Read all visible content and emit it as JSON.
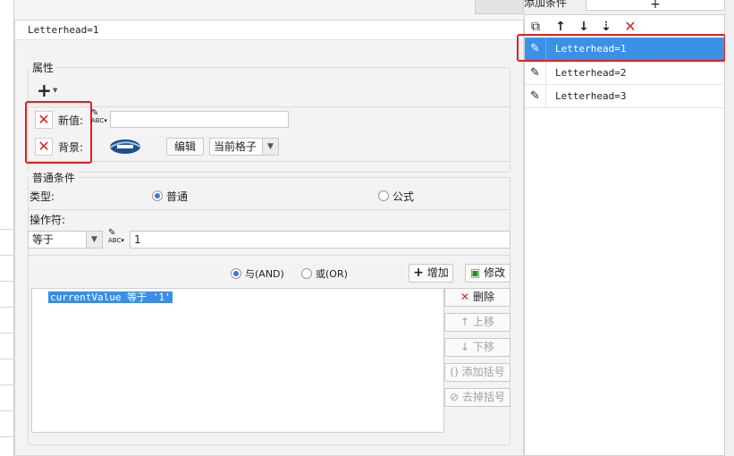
{
  "right_panel": {
    "header_label": "添加条件",
    "add_symbol": "+",
    "toolbar": {
      "copy_icon": "copy-icon",
      "up_icon": "arrow-up-icon",
      "down_icon": "arrow-down-icon",
      "sort_icon": "sort-down-icon",
      "delete_icon": "delete-x-icon"
    },
    "items": [
      {
        "label": "Letterhead=1",
        "selected": true
      },
      {
        "label": "Letterhead=2",
        "selected": false
      },
      {
        "label": "Letterhead=3",
        "selected": false
      }
    ]
  },
  "dialog": {
    "title": "Letterhead=1",
    "attributes": {
      "group_label": "属性",
      "add_symbol": "+",
      "new_value_label": "新值:",
      "new_value_input": "",
      "background_label": "背景:",
      "edit_button": "编辑",
      "background_select": "当前格子"
    },
    "condition": {
      "group_label": "普通条件",
      "type_label": "类型:",
      "type_normal": "普通",
      "type_formula": "公式",
      "type_selected": "normal",
      "operator_label": "操作符:",
      "operator_value": "等于",
      "operand_value": "1",
      "and_label": "与(AND)",
      "or_label": "或(OR)",
      "logic_selected": "and",
      "add_button": "增加",
      "modify_button": "修改",
      "list": [
        "currentValue 等于 '1'"
      ],
      "delete_button": "删除",
      "move_up_button": "上移",
      "move_down_button": "下移",
      "add_paren_button": "添加括号",
      "remove_paren_button": "去掉括号"
    }
  },
  "colors": {
    "selection_blue": "#3a91e6",
    "highlight_red": "#e0201f",
    "delete_red": "#e02020"
  }
}
